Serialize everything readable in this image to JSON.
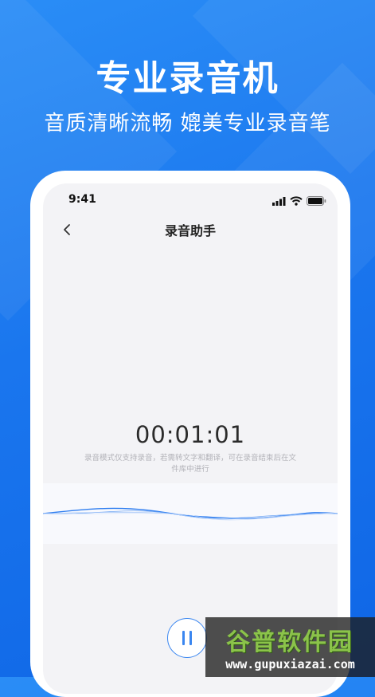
{
  "promo": {
    "headline": "专业录音机",
    "subline": "音质清晰流畅 媲美专业录音笔"
  },
  "status_bar": {
    "time": "9:41"
  },
  "nav": {
    "title": "录音助手"
  },
  "recorder": {
    "timer": "00:01:01",
    "hint": "录音模式仅支持录音，若需转文字和翻译，可在录音结束后在文件库中进行"
  },
  "watermark": {
    "title": "谷普软件园",
    "url": "www.gupuxiazai.com"
  },
  "colors": {
    "background": "#1a76ee",
    "accent": "#3a86f0",
    "screen": "#f3f3f6"
  },
  "icons": {
    "back": "chevron-left-icon",
    "signal": "signal-icon",
    "wifi": "wifi-icon",
    "battery": "battery-icon",
    "pause": "pause-icon"
  }
}
